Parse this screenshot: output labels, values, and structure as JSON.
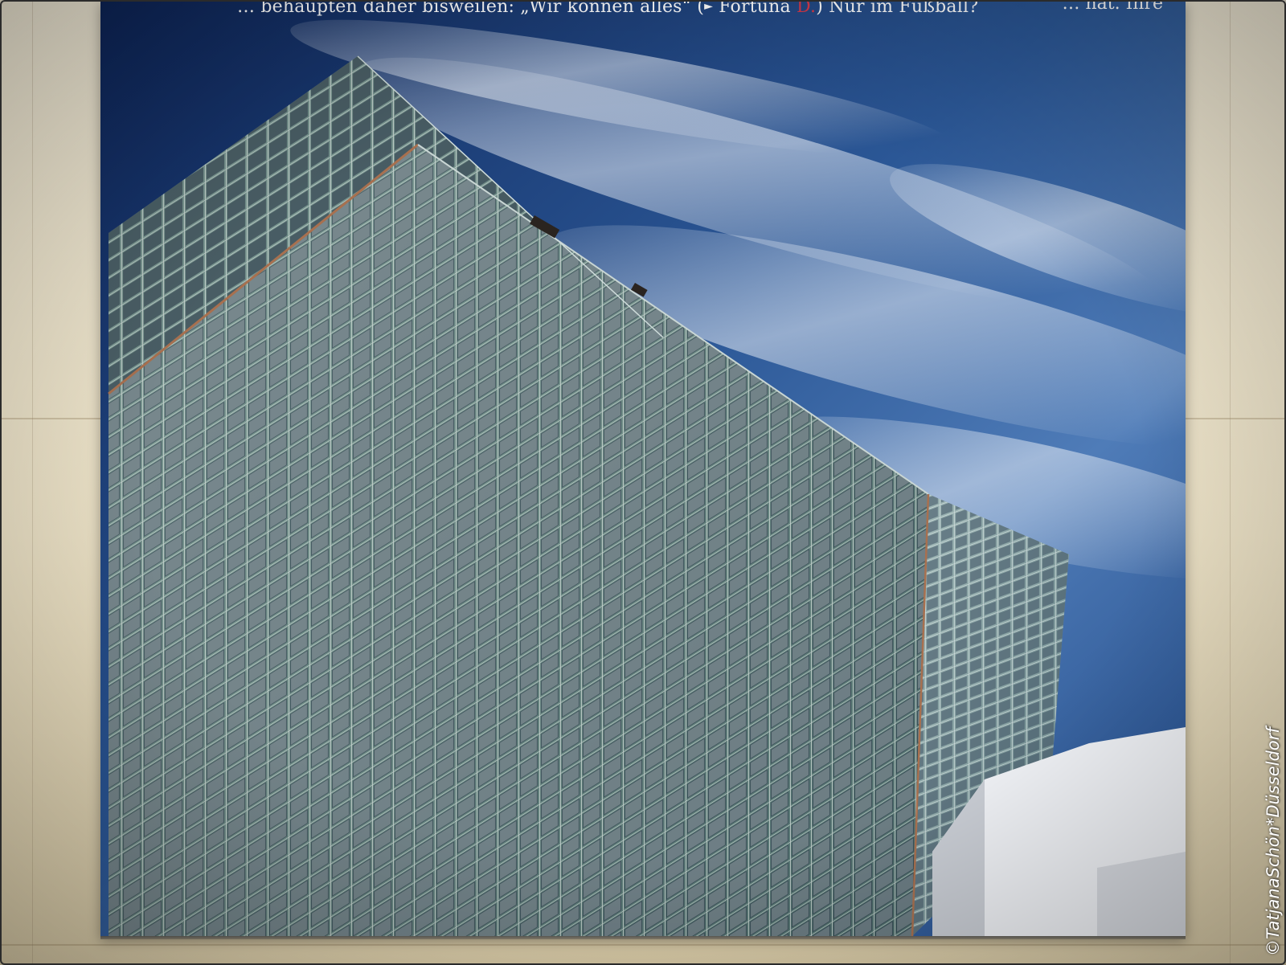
{
  "cover": {
    "text_line1": "… behaupten daher bisweilen: „Wir können alles“ (",
    "arrow_glyph": "►",
    "text_fortuna": " Fortuna ",
    "text_d": "D.",
    "text_tail": ") Nur im Fußball?",
    "top_right_fragment": "… hat. Ihre",
    "accent_color": "#d83a4a",
    "sky_color": "#24508f"
  },
  "watermark": {
    "text": "©TatjanaSchön*Düsseldorf"
  },
  "photo": {
    "subject": "high-rise-glass-facade-building",
    "icons": [
      "right-triangle-arrow-icon"
    ]
  }
}
